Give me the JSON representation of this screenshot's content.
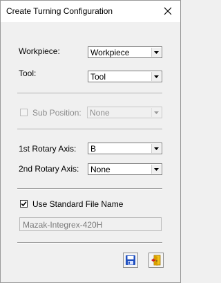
{
  "window": {
    "title": "Create Turning Configuration"
  },
  "fields": {
    "workpiece": {
      "label": "Workpiece:",
      "value": "Workpiece"
    },
    "tool": {
      "label": "Tool:",
      "value": "Tool"
    },
    "sub_position": {
      "label": "Sub Position:",
      "value": "None",
      "enabled": false,
      "checked": false
    },
    "rotary1": {
      "label": "1st Rotary Axis:",
      "value": "B"
    },
    "rotary2": {
      "label": "2nd Rotary Axis:",
      "value": "None"
    },
    "use_standard_file_name": {
      "label": "Use Standard File Name",
      "checked": true
    },
    "file_name": {
      "value": "Mazak-Integrex-420H"
    }
  },
  "buttons": {
    "save_icon": "floppy-disk-icon",
    "exit_icon": "exit-door-icon"
  },
  "colors": {
    "icon_blue": "#1f4fbf",
    "exit_yellow": "#f2c21a",
    "exit_red": "#d02020"
  }
}
